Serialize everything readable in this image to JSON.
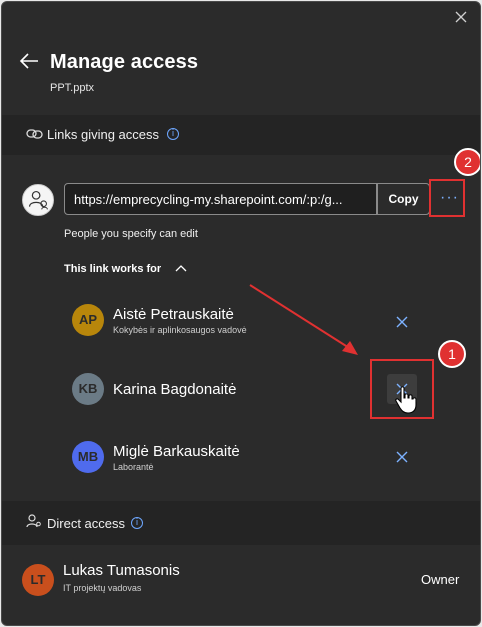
{
  "dialog": {
    "title": "Manage access",
    "file_name": "PPT.pptx"
  },
  "links_section": {
    "label": "Links giving access",
    "link_url": "https://emprecycling-my.sharepoint.com/:p:/g...",
    "copy_label": "Copy",
    "more_label": "···",
    "permission_text": "People you specify can edit",
    "works_for_label": "This link works for"
  },
  "link_people": [
    {
      "initials": "AP",
      "name": "Aistė Petrauskaitė",
      "role": "Kokybės ir aplinkosaugos vadovė",
      "avatar_color": "#b8860b"
    },
    {
      "initials": "KB",
      "name": "Karina Bagdonaitė",
      "role": "",
      "avatar_color": "#6b7b86"
    },
    {
      "initials": "MB",
      "name": "Miglė Barkauskaitė",
      "role": "Laborantė",
      "avatar_color": "#4f6bed"
    }
  ],
  "direct_section": {
    "label": "Direct access"
  },
  "owner": {
    "initials": "LT",
    "name": "Lukas Tumasonis",
    "role": "IT projektų vadovas",
    "permission": "Owner",
    "avatar_color": "#c94f1d"
  },
  "annotations": {
    "badge_1": "1",
    "badge_2": "2",
    "highlight_color": "#e03131"
  },
  "colors": {
    "background": "#2b2b2b",
    "section_band": "#242424",
    "accent": "#7db2ff"
  }
}
